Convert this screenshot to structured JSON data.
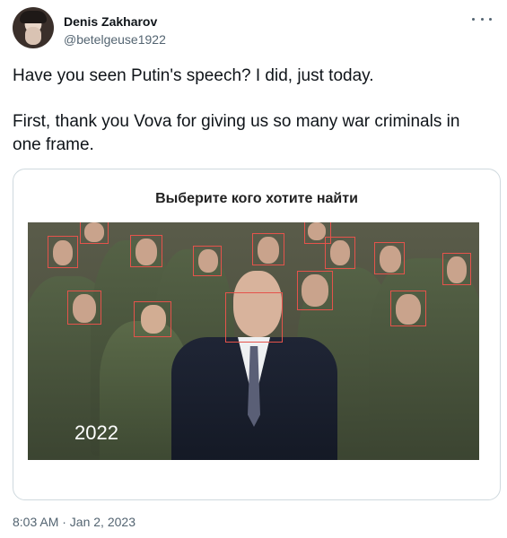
{
  "author": {
    "name": "Denis Zakharov",
    "handle": "@betelgeuse1922",
    "avatar_icon": "user-avatar"
  },
  "more_icon": "more-options-icon",
  "tweet": {
    "paragraphs": [
      "Have you seen Putin's speech? I did, just today.",
      "First, thank you Vova for giving us so many war criminals in one frame."
    ]
  },
  "media": {
    "caption": "Выберите кого хотите найти",
    "year_overlay": "2022"
  },
  "timestamp": "8:03 AM · Jan 2, 2023",
  "colors": {
    "text_primary": "#0f1419",
    "text_secondary": "#536471",
    "highlight_box": "#e5534b",
    "card_border": "#cfd9de"
  }
}
